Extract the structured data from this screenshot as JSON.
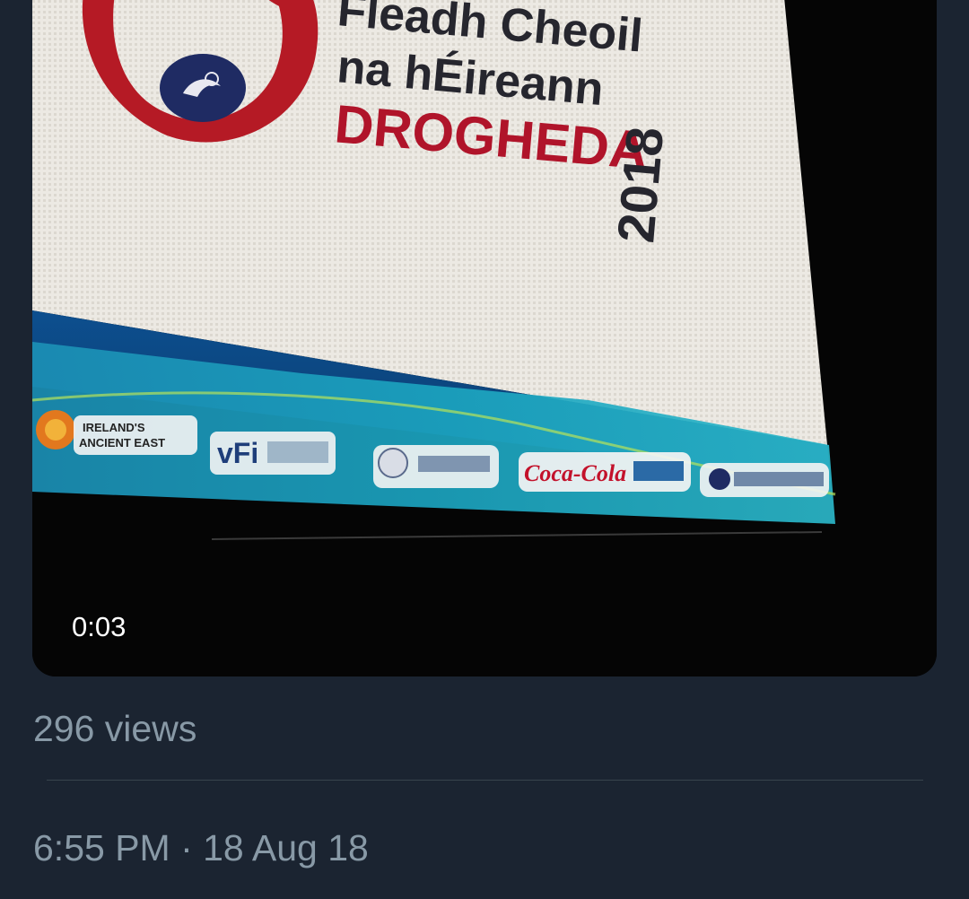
{
  "video": {
    "duration": "0:03",
    "frame": {
      "headline_line1": "Fleadh Cheoil",
      "headline_line2": "na hÉireann",
      "headline_city": "DROGHEDA",
      "headline_year": "2018",
      "sponsor_ancient_east_l1": "IRELAND'S",
      "sponsor_ancient_east_l2": "ANCIENT EAST",
      "sponsor_vfi": "vFi",
      "sponsor_cocacola": "Coca-Cola",
      "colors": {
        "screen": "#eae8e2",
        "headline": "#26262e",
        "city": "#b0142a",
        "logo_red": "#b51a25",
        "logo_navy": "#1f2b63",
        "banner_blue": "#0d4f8f",
        "banner_teal": "#1ba3bf"
      }
    }
  },
  "tweet": {
    "views": "296 views",
    "timestamp": "6:55 PM · 18 Aug 18"
  },
  "colors": {
    "background": "#1b2431",
    "meta_text": "#8899a6",
    "divider": "#38444d"
  }
}
